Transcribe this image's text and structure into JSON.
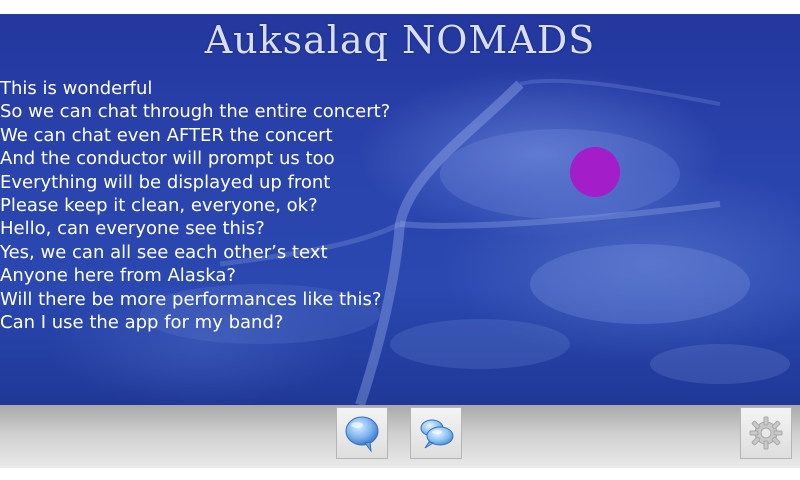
{
  "app": {
    "title": "Auksalaq NOMADS"
  },
  "chat": {
    "messages": [
      "This is wonderful",
      "So we can chat through the entire concert?",
      "We can chat even AFTER the concert",
      "And the conductor will prompt us too",
      "Everything will be displayed up front",
      "Please keep it clean, everyone, ok?",
      "Hello, can everyone see this?",
      "Yes, we can all see each other’s text",
      "Anyone here from Alaska?",
      "Will there be more performances like this?",
      "Can I use the app for my band?"
    ]
  },
  "toolbar": {
    "buttons": [
      {
        "id": "chat",
        "icon": "speech-bubble-icon"
      },
      {
        "id": "messages",
        "icon": "cloud-bubbles-icon"
      },
      {
        "id": "settings",
        "icon": "gear-icon"
      }
    ]
  },
  "colors": {
    "background_blue": "#2a44ad",
    "cursor_dot": "#a31ec9",
    "toolbar_gray": "#cfcfcf",
    "text": "#ffffff"
  }
}
